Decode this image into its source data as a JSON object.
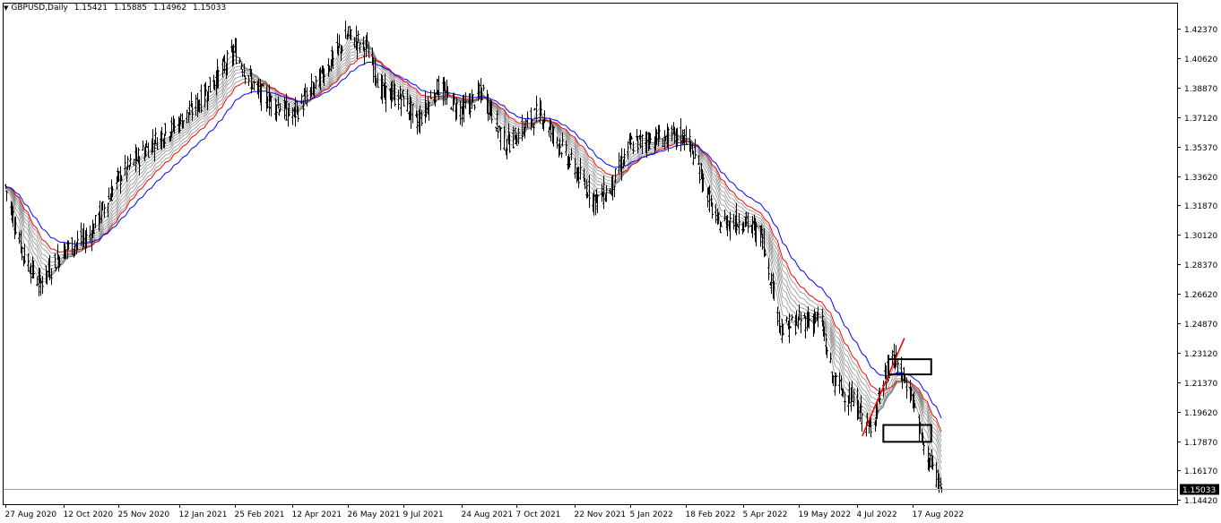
{
  "header": {
    "symbol": "GBPUSD,Daily",
    "ohlc": [
      "1.15421",
      "1.15885",
      "1.14962",
      "1.15033"
    ]
  },
  "price_axis": {
    "ticks": [
      "1.42370",
      "1.40620",
      "1.38870",
      "1.37120",
      "1.35370",
      "1.33620",
      "1.31870",
      "1.30120",
      "1.28370",
      "1.26620",
      "1.24870",
      "1.23120",
      "1.21370",
      "1.19620",
      "1.17870",
      "1.16170",
      "1.14420"
    ],
    "current_price": "1.15033"
  },
  "time_axis": {
    "labels": [
      "27 Aug 2020",
      "12 Oct 2020",
      "25 Nov 2020",
      "12 Jan 2021",
      "25 Feb 2021",
      "12 Apr 2021",
      "26 May 2021",
      "9 Jul 2021",
      "24 Aug 2021",
      "7 Oct 2021",
      "22 Nov 2021",
      "5 Jan 2022",
      "18 Feb 2022",
      "5 Apr 2022",
      "19 May 2022",
      "4 Jul 2022",
      "17 Aug 2022"
    ]
  },
  "colors": {
    "background": "#ffffff",
    "bars": "#000000",
    "ma_fast": "#808080",
    "ma_red": "#ff0000",
    "ma_blue": "#0000ff",
    "trendline": "#ff0000",
    "box": "#000000",
    "current_price_bg": "#000000"
  },
  "chart_data": {
    "type": "ohlc",
    "y_range": [
      1.1415,
      1.4385
    ],
    "close_path": [
      [
        "27 Aug 2020",
        1.33
      ],
      [
        "2020-09-10",
        1.29
      ],
      [
        "2020-09-23",
        1.272
      ],
      [
        "12 Oct 2020",
        1.292
      ],
      [
        "2020-11-01",
        1.3
      ],
      [
        "25 Nov 2020",
        1.335
      ],
      [
        "2020-12-20",
        1.355
      ],
      [
        "12 Jan 2021",
        1.368
      ],
      [
        "2021-01-28",
        1.38
      ],
      [
        "25 Feb 2021",
        1.41
      ],
      [
        "2021-03-15",
        1.386
      ],
      [
        "12 Apr 2021",
        1.372
      ],
      [
        "2021-04-30",
        1.39
      ],
      [
        "26 May 2021",
        1.42
      ],
      [
        "2021-06-10",
        1.412
      ],
      [
        "2021-06-22",
        1.386
      ],
      [
        "9 Jul 2021",
        1.382
      ],
      [
        "2021-07-20",
        1.368
      ],
      [
        "2021-08-05",
        1.389
      ],
      [
        "24 Aug 2021",
        1.375
      ],
      [
        "2021-09-10",
        1.386
      ],
      [
        "2021-09-28",
        1.355
      ],
      [
        "7 Oct 2021",
        1.36
      ],
      [
        "2021-10-25",
        1.375
      ],
      [
        "22 Nov 2021",
        1.34
      ],
      [
        "2021-12-08",
        1.322
      ],
      [
        "2021-12-20",
        1.328
      ],
      [
        "5 Jan 2022",
        1.355
      ],
      [
        "2022-01-20",
        1.358
      ],
      [
        "18 Feb 2022",
        1.36
      ],
      [
        "2022-03-01",
        1.34
      ],
      [
        "2022-03-15",
        1.308
      ],
      [
        "5 Apr 2022",
        1.31
      ],
      [
        "2022-04-20",
        1.3
      ],
      [
        "2022-05-05",
        1.245
      ],
      [
        "19 May 2022",
        1.25
      ],
      [
        "2022-06-05",
        1.252
      ],
      [
        "2022-06-15",
        1.215
      ],
      [
        "4 Jul 2022",
        1.2
      ],
      [
        "2022-07-14",
        1.185
      ],
      [
        "2022-08-01",
        1.23
      ],
      [
        "17 Aug 2022",
        1.205
      ],
      [
        "2022-08-25",
        1.178
      ],
      [
        "2022-09-05",
        1.158
      ],
      [
        "2022-09-09",
        1.15
      ]
    ],
    "moving_averages": [
      {
        "color": "ma_red",
        "lag_days": 34
      },
      {
        "color": "ma_blue",
        "lag_days": 48
      }
    ],
    "trendline": [
      [
        "4 Jul 2022",
        1.182
      ],
      [
        "2022-08-05",
        1.24
      ]
    ],
    "boxes": [
      {
        "x": [
          "2022-07-29",
          "2022-09-01"
        ],
        "y": [
          1.2185,
          1.2275
        ]
      },
      {
        "x": [
          "2022-07-25",
          "2022-09-01"
        ],
        "y": [
          1.1785,
          1.1885
        ]
      }
    ]
  }
}
